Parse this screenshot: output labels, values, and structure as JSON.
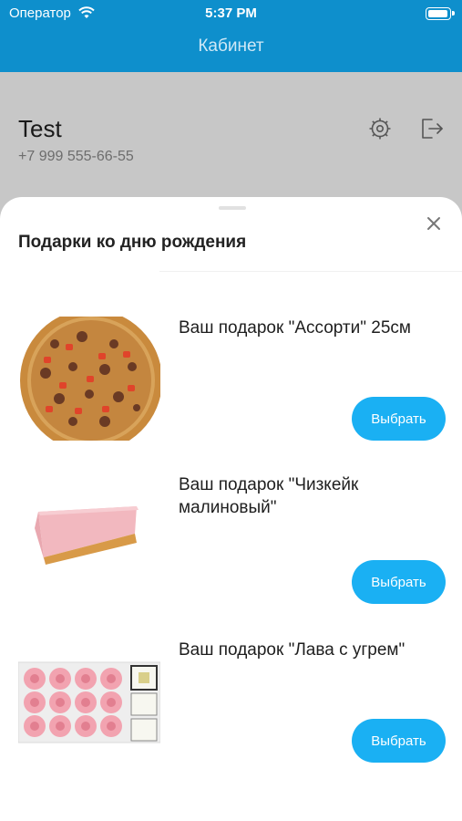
{
  "status_bar": {
    "carrier": "Оператор",
    "time": "5:37 PM"
  },
  "nav": {
    "title": "Кабинет"
  },
  "profile": {
    "name": "Test",
    "phone": "+7 999 555-66-55"
  },
  "icons": {
    "settings": "gear-icon",
    "logout": "logout-icon",
    "close": "close-icon"
  },
  "sheet": {
    "title": "Подарки ко дню рождения",
    "gifts": [
      {
        "title": "Ваш подарок \"Ассорти\" 25см",
        "button": "Выбрать",
        "image": "pizza"
      },
      {
        "title": "Ваш подарок \"Чизкейк малиновый\"",
        "button": "Выбрать",
        "image": "cheesecake"
      },
      {
        "title": "Ваш подарок \"Лава с угрем\"",
        "button": "Выбрать",
        "image": "sushi-rolls"
      }
    ]
  },
  "colors": {
    "header": "#0e8fcc",
    "button": "#1ab0f3",
    "backdrop": "#c7c7c7"
  }
}
